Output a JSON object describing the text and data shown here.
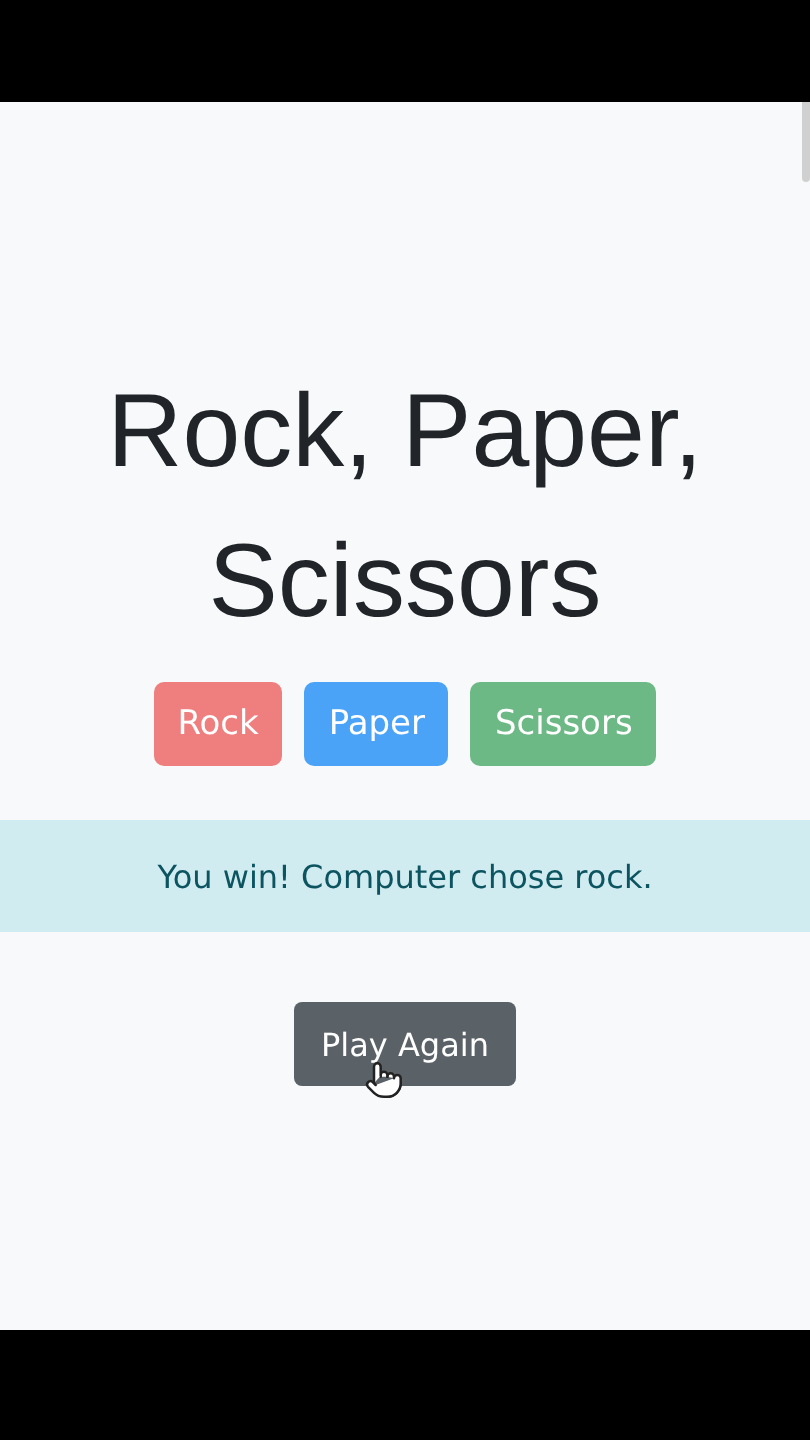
{
  "title": "Rock, Paper, Scissors",
  "choices": [
    {
      "label": "Rock",
      "color": "#ef7f7f"
    },
    {
      "label": "Paper",
      "color": "#4aa3f7"
    },
    {
      "label": "Scissors",
      "color": "#6cb986"
    }
  ],
  "result": "You win! Computer chose rock.",
  "play_again_button": "Play Again"
}
